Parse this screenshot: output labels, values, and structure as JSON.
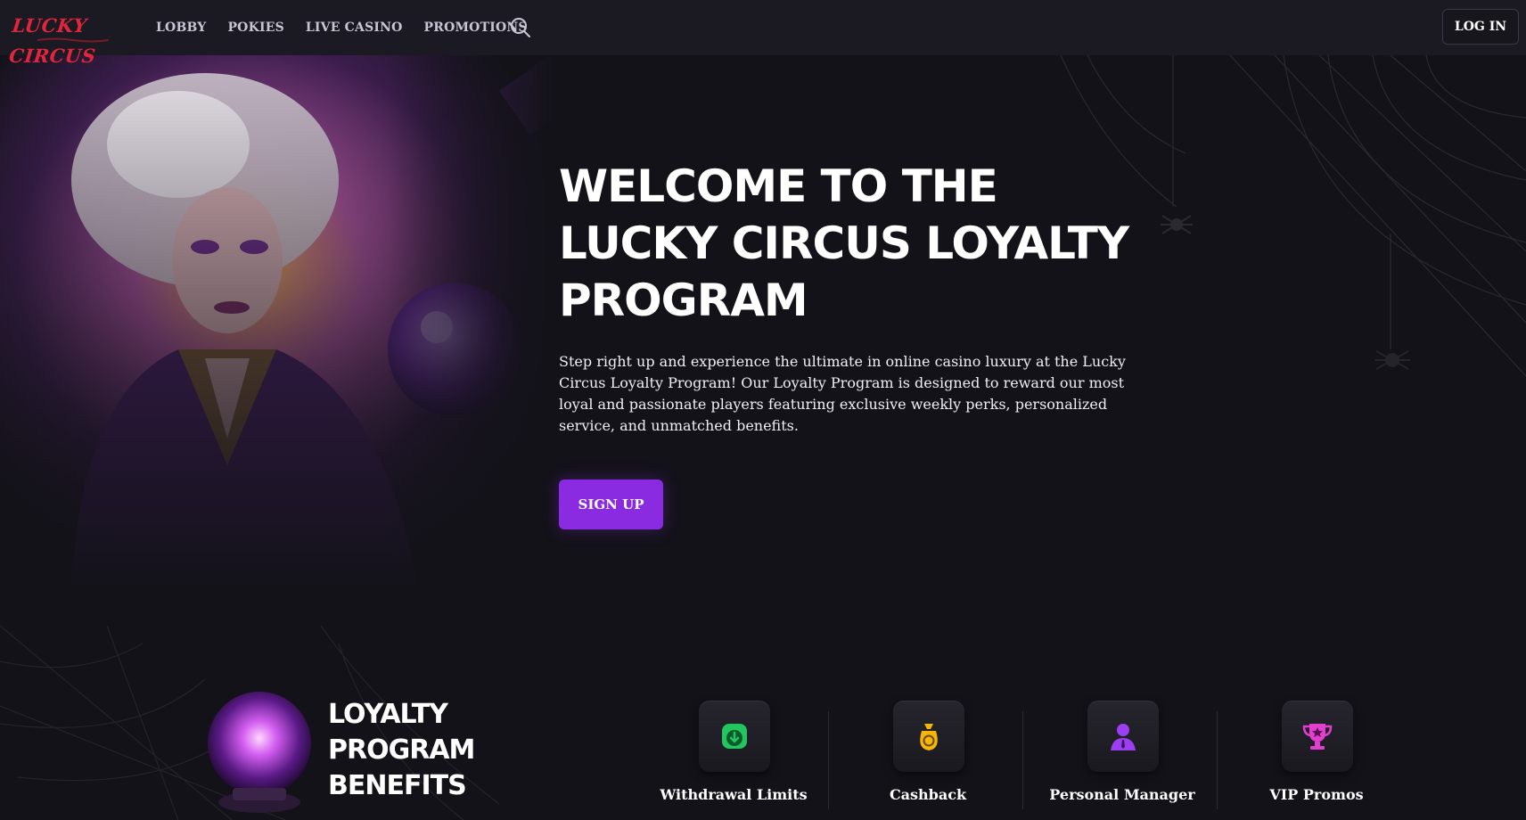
{
  "brand": {
    "logo_text": "LUCKY CIRCUS",
    "accent": "#8a2be2",
    "logo_color": "#e0263c"
  },
  "nav": {
    "items": [
      {
        "label": "LOBBY"
      },
      {
        "label": "POKIES"
      },
      {
        "label": "LIVE CASINO"
      },
      {
        "label": "PROMOTIONS"
      }
    ],
    "search_icon": "search-icon",
    "login_label": "LOG IN"
  },
  "hero": {
    "title_lines": [
      "WELCOME TO THE",
      "LUCKY CIRCUS LOYALTY",
      "PROGRAM"
    ],
    "description": "Step right up and experience the ultimate in online casino luxury at the Lucky Circus Loyalty Program! Our Loyalty Program is designed to reward our most loyal and passionate players featuring exclusive weekly perks, personalized service, and unmatched benefits.",
    "signup_label": "SIGN UP"
  },
  "benefits": {
    "title_lines": [
      "LOYALTY",
      "PROGRAM",
      "BENEFITS"
    ],
    "items": [
      {
        "label": "Withdrawal Limits",
        "icon": "withdrawal-icon",
        "color": "#22c55e"
      },
      {
        "label": "Cashback",
        "icon": "cashback-bag-icon",
        "color": "#f5b50a"
      },
      {
        "label": "Personal Manager",
        "icon": "person-icon",
        "color": "#9b3ff0"
      },
      {
        "label": "VIP Promos",
        "icon": "trophy-icon",
        "color": "#e23fcf"
      }
    ]
  }
}
